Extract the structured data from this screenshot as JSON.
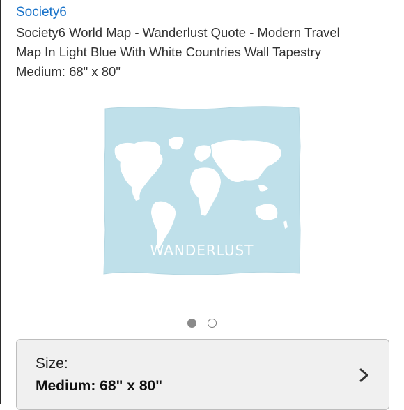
{
  "header": {
    "brand": "Society6"
  },
  "product": {
    "title_lines": [
      "Society6 World Map - Wanderlust Quote - Modern Travel",
      "Map In Light Blue With White Countries Wall Tapestry"
    ],
    "size_line": "Medium: 68\" x 80\"",
    "image_text": "WANDERLUST",
    "colors": {
      "brand": "#1a73c9",
      "tapestry_fill": "#bfe0ea",
      "continents": "#ffffff"
    }
  },
  "carousel": {
    "dots": [
      "active",
      "inactive"
    ]
  },
  "size_selector": {
    "label": "Size:",
    "value": "Medium: 68\" x 80\"",
    "chevron_icon": "chevron-right-icon"
  }
}
